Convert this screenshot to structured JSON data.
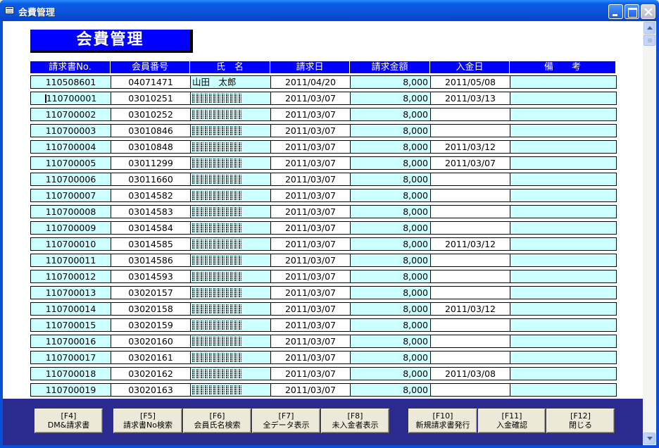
{
  "window": {
    "title": "会費管理",
    "icon": "form-icon"
  },
  "header": {
    "title": "会費管理"
  },
  "columns": [
    "請求書No.",
    "会員番号",
    "氏　名",
    "請求日",
    "請求金額",
    "入金日",
    "備　　考"
  ],
  "rows": [
    {
      "invoice": "110508601",
      "member": "04071471",
      "name": "山田　太郎",
      "name_masked": false,
      "date": "2011/04/20",
      "amount": "8,000",
      "paid": "2011/05/08",
      "note": ""
    },
    {
      "invoice": "110700001",
      "member": "03010251",
      "name": "",
      "name_masked": true,
      "date": "2011/03/07",
      "amount": "8,000",
      "paid": "2011/03/13",
      "note": ""
    },
    {
      "invoice": "110700002",
      "member": "03010252",
      "name": "",
      "name_masked": true,
      "date": "2011/03/07",
      "amount": "8,000",
      "paid": "",
      "note": ""
    },
    {
      "invoice": "110700003",
      "member": "03010846",
      "name": "",
      "name_masked": true,
      "date": "2011/03/07",
      "amount": "8,000",
      "paid": "",
      "note": ""
    },
    {
      "invoice": "110700004",
      "member": "03010848",
      "name": "",
      "name_masked": true,
      "date": "2011/03/07",
      "amount": "8,000",
      "paid": "2011/03/12",
      "note": ""
    },
    {
      "invoice": "110700005",
      "member": "03011299",
      "name": "",
      "name_masked": true,
      "date": "2011/03/07",
      "amount": "8,000",
      "paid": "2011/03/07",
      "note": ""
    },
    {
      "invoice": "110700006",
      "member": "03011660",
      "name": "",
      "name_masked": true,
      "date": "2011/03/07",
      "amount": "8,000",
      "paid": "",
      "note": ""
    },
    {
      "invoice": "110700007",
      "member": "03014582",
      "name": "",
      "name_masked": true,
      "date": "2011/03/07",
      "amount": "8,000",
      "paid": "",
      "note": ""
    },
    {
      "invoice": "110700008",
      "member": "03014583",
      "name": "",
      "name_masked": true,
      "date": "2011/03/07",
      "amount": "8,000",
      "paid": "",
      "note": ""
    },
    {
      "invoice": "110700009",
      "member": "03014584",
      "name": "",
      "name_masked": true,
      "date": "2011/03/07",
      "amount": "8,000",
      "paid": "",
      "note": ""
    },
    {
      "invoice": "110700010",
      "member": "03014585",
      "name": "",
      "name_masked": true,
      "date": "2011/03/07",
      "amount": "8,000",
      "paid": "2011/03/12",
      "note": ""
    },
    {
      "invoice": "110700011",
      "member": "03014586",
      "name": "",
      "name_masked": true,
      "date": "2011/03/07",
      "amount": "8,000",
      "paid": "",
      "note": ""
    },
    {
      "invoice": "110700012",
      "member": "03014593",
      "name": "",
      "name_masked": true,
      "date": "2011/03/07",
      "amount": "8,000",
      "paid": "",
      "note": ""
    },
    {
      "invoice": "110700013",
      "member": "03020157",
      "name": "",
      "name_masked": true,
      "date": "2011/03/07",
      "amount": "8,000",
      "paid": "",
      "note": ""
    },
    {
      "invoice": "110700014",
      "member": "03020158",
      "name": "",
      "name_masked": true,
      "date": "2011/03/07",
      "amount": "8,000",
      "paid": "2011/03/12",
      "note": ""
    },
    {
      "invoice": "110700015",
      "member": "03020159",
      "name": "",
      "name_masked": true,
      "date": "2011/03/07",
      "amount": "8,000",
      "paid": "",
      "note": ""
    },
    {
      "invoice": "110700016",
      "member": "03020160",
      "name": "",
      "name_masked": true,
      "date": "2011/03/07",
      "amount": "8,000",
      "paid": "",
      "note": ""
    },
    {
      "invoice": "110700017",
      "member": "03020161",
      "name": "",
      "name_masked": true,
      "date": "2011/03/07",
      "amount": "8,000",
      "paid": "",
      "note": ""
    },
    {
      "invoice": "110700018",
      "member": "03020162",
      "name": "",
      "name_masked": true,
      "date": "2011/03/07",
      "amount": "8,000",
      "paid": "2011/03/08",
      "note": ""
    },
    {
      "invoice": "110700019",
      "member": "03020163",
      "name": "",
      "name_masked": true,
      "date": "2011/03/07",
      "amount": "8,000",
      "paid": "",
      "note": ""
    }
  ],
  "footer_buttons": [
    {
      "key": "[F4]",
      "label": "DM&請求書"
    },
    {
      "key": "[F5]",
      "label": "請求書No検索"
    },
    {
      "key": "[F6]",
      "label": "会員氏名検索"
    },
    {
      "key": "[F7]",
      "label": "全データ表示"
    },
    {
      "key": "[F8]",
      "label": "未入金者表示"
    },
    {
      "key": "[F10]",
      "label": "新規請求書発行"
    },
    {
      "key": "[F11]",
      "label": "入金確認"
    },
    {
      "key": "[F12]",
      "label": "閉じる"
    }
  ],
  "colors": {
    "header_blue": "#0000ff",
    "row_cyan": "#ccffff",
    "footer_navy": "#2a2a8f",
    "titlebar": "#0a52d9"
  }
}
